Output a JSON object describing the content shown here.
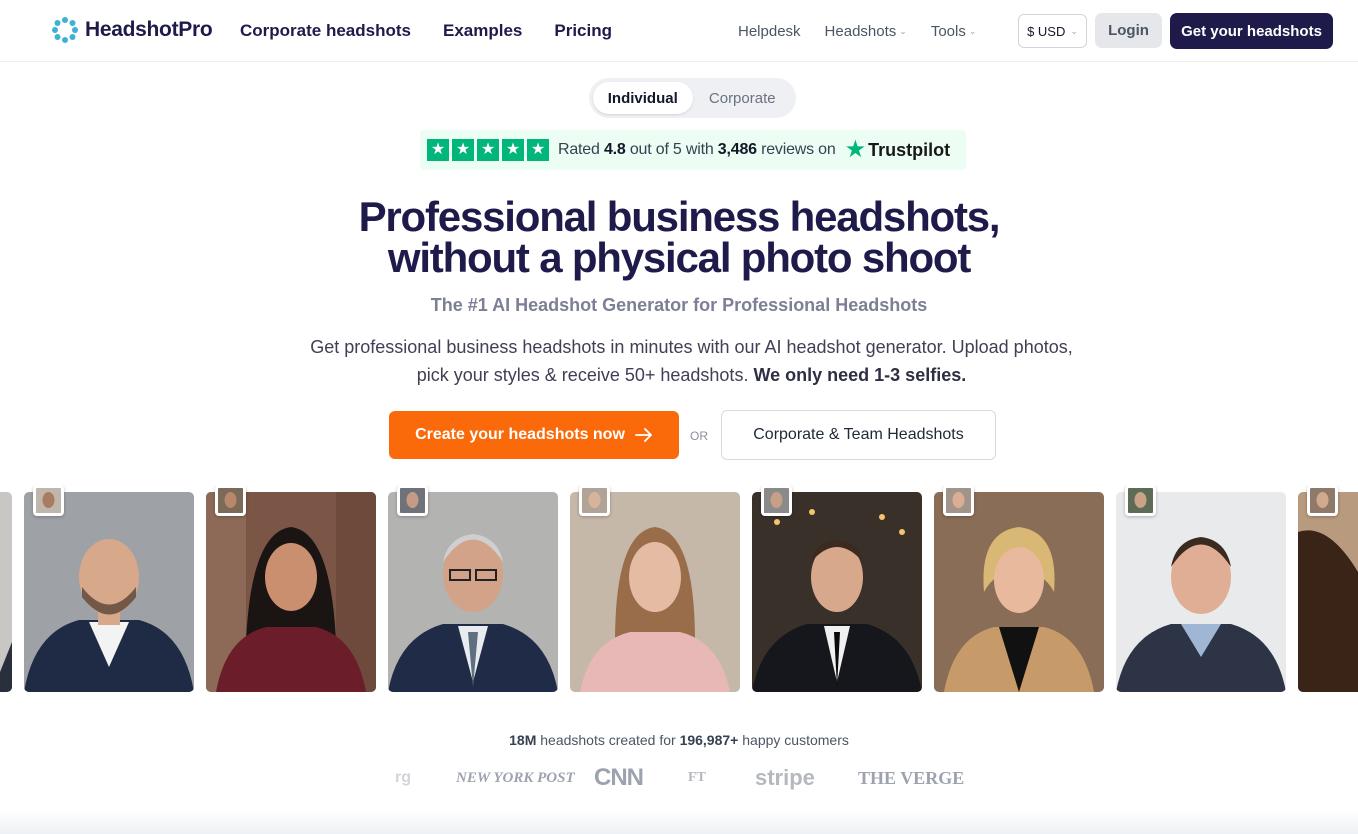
{
  "nav": {
    "logo_text": "HeadshotPro",
    "primary_links": [
      "Corporate headshots",
      "Examples",
      "Pricing"
    ],
    "helpdesk": "Helpdesk",
    "headshots_menu": "Headshots",
    "tools_menu": "Tools",
    "currency": "$ USD",
    "login": "Login",
    "cta": "Get your headshots"
  },
  "toggle": {
    "individual": "Individual",
    "corporate": "Corporate",
    "active": "Individual"
  },
  "trustpilot": {
    "rated": "Rated",
    "rating": "4.8",
    "out_of": "out of 5 with",
    "reviews_count": "3,486",
    "reviews_on": "reviews on",
    "brand": "Trustpilot",
    "stars": 5
  },
  "hero": {
    "headline_line1": "Professional business headshots,",
    "headline_line2": "without a physical photo shoot",
    "subheadline": "The #1 AI Headshot Generator for Professional Headshots",
    "description": "Get professional business headshots in minutes with our AI headshot generator. Upload photos, pick your styles & receive 50+ headshots.",
    "description_bold": "We only need 1-3 selfies.",
    "cta_primary": "Create your headshots now",
    "or": "OR",
    "cta_secondary": "Corporate & Team Headshots"
  },
  "stats": {
    "count": "18M",
    "text1": "headshots created for",
    "customers": "196,987+",
    "text2": "happy customers"
  },
  "press_logos": [
    "NEW YORK POST",
    "CNN",
    "FT",
    "stripe",
    "THE VERGE"
  ],
  "colors": {
    "navy": "#1e1b4b",
    "orange": "#fb6a0a",
    "trustpilot_green": "#00b67a"
  }
}
